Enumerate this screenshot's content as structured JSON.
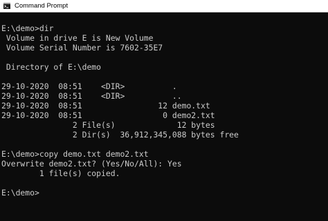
{
  "window": {
    "title": "Command Prompt",
    "icon": "cmd-icon",
    "colors": {
      "titlebar_bg": "#ffffff",
      "title_text": "#000000",
      "console_bg": "#0c0c0c",
      "console_text": "#cccccc"
    }
  },
  "console": {
    "lines": [
      "E:\\demo>dir",
      " Volume in drive E is New Volume",
      " Volume Serial Number is 7602-35E7",
      "",
      " Directory of E:\\demo",
      "",
      "29-10-2020  08:51    <DIR>          .",
      "29-10-2020  08:51    <DIR>          ..",
      "29-10-2020  08:51                12 demo.txt",
      "29-10-2020  08:51                 0 demo2.txt",
      "               2 File(s)             12 bytes",
      "               2 Dir(s)  36,912,345,088 bytes free",
      "",
      "E:\\demo>copy demo.txt demo2.txt",
      "Overwrite demo2.txt? (Yes/No/All): Yes",
      "        1 file(s) copied.",
      "",
      "E:\\demo>"
    ]
  }
}
